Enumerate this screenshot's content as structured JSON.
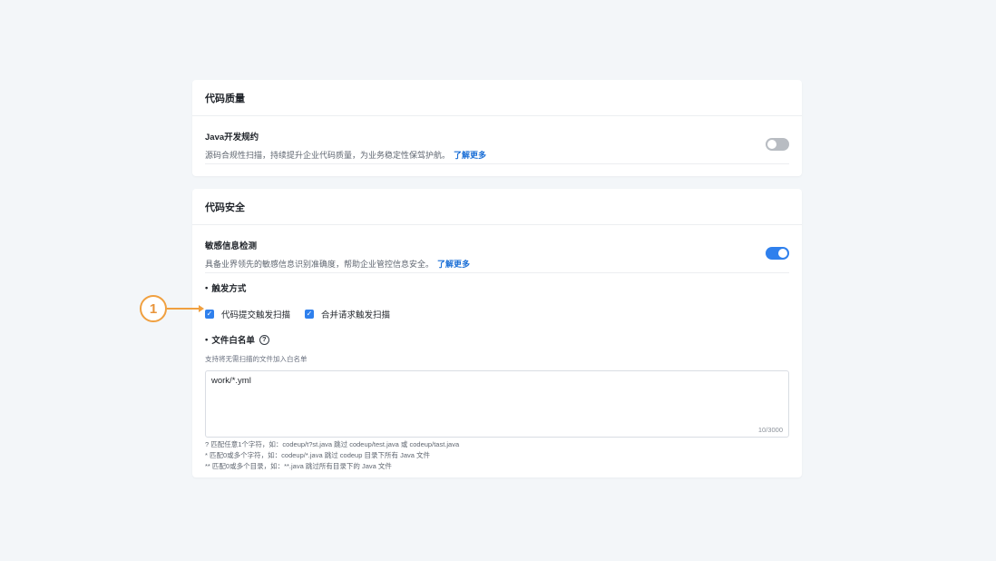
{
  "colors": {
    "page_background": "#f3f6f9",
    "link": "#1b6fd6",
    "toggle_on": "#2f80ed",
    "toggle_off": "#b8bcc2",
    "checkbox": "#2f80ed",
    "callout": "#f0a040"
  },
  "code_quality": {
    "title": "代码质量",
    "java_rule": {
      "title": "Java开发规约",
      "description": "源码合规性扫描，持续提升企业代码质量，为业务稳定性保驾护航。",
      "link": "了解更多",
      "enabled": false
    }
  },
  "code_security": {
    "title": "代码安全",
    "sensitive_info": {
      "title": "敏感信息检测",
      "description": "具备业界领先的敏感信息识别准确度，帮助企业管控信息安全。",
      "link": "了解更多",
      "enabled": true
    },
    "trigger": {
      "label": "触发方式",
      "options": [
        {
          "label": "代码提交触发扫描",
          "checked": true
        },
        {
          "label": "合并请求触发扫描",
          "checked": true
        }
      ]
    },
    "whitelist": {
      "label": "文件白名单",
      "help_icon": "?",
      "hint": "支持将无需扫描的文件加入白名单",
      "value": "work/*.yml",
      "counter": "10/3000",
      "rules": [
        "?   匹配任意1个字符，如：codeup/t?st.java 跳过 codeup/test.java 或 codeup/tast.java",
        "*   匹配0或多个字符，如：codeup/*.java 跳过 codeup 目录下所有 Java 文件",
        "**  匹配0或多个目录，如：**.java 跳过所有目录下的 Java 文件"
      ]
    }
  },
  "callout": {
    "number": "1"
  }
}
